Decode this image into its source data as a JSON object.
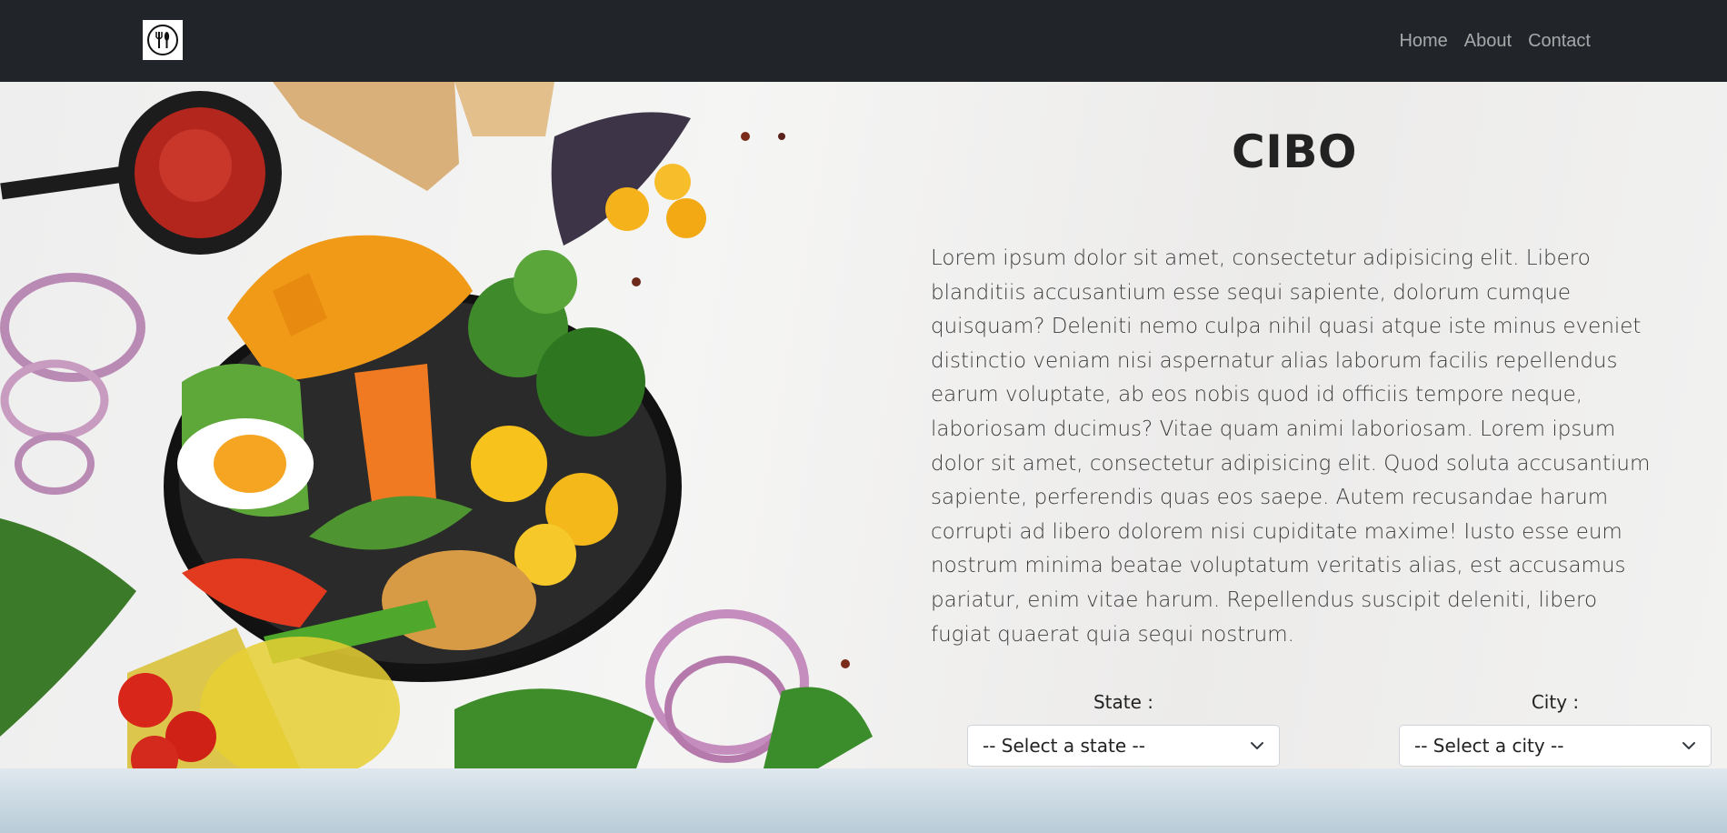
{
  "nav": {
    "logo_icon": "utensils-logo-icon",
    "links": [
      "Home",
      "About",
      "Contact"
    ]
  },
  "hero": {
    "title": "CIBO",
    "description": "Lorem ipsum dolor sit amet, consectetur adipisicing elit. Libero blanditiis accusantium esse sequi sapiente, dolorum cumque quisquam? Deleniti nemo culpa nihil quasi atque iste minus eveniet distinctio veniam nisi aspernatur alias laborum facilis repellendus earum voluptate, ab eos nobis quod id officiis tempore neque, laboriosam ducimus? Vitae quam animi laboriosam. Lorem ipsum dolor sit amet, consectetur adipisicing elit. Quod soluta accusantium sapiente, perferendis quas eos saepe. Autem recusandae harum corrupti ad libero dolorem nisi cupiditate maxime! Iusto esse eum nostrum minima beatae voluptatum veritatis alias, est accusamus pariatur, enim vitae harum. Repellendus suscipit deleniti, libero fugiat quaerat quia sequi nostrum.",
    "state_label": "State :",
    "state_value": "-- Select a state --",
    "city_label": "City :",
    "city_value": "-- Select a city --"
  },
  "colors": {
    "navbar": "#212529",
    "nav_link": "rgba(255,255,255,0.6)"
  }
}
